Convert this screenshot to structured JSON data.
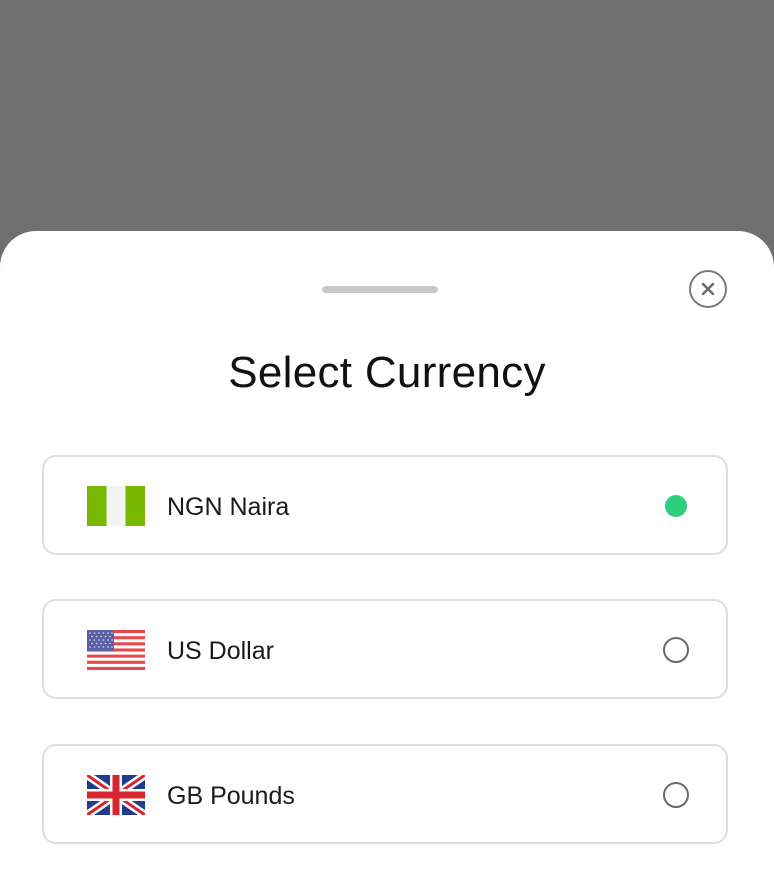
{
  "sheet": {
    "title": "Select Currency"
  },
  "currencies": [
    {
      "label": "NGN Naira",
      "flag": "nigeria-flag-icon",
      "selected": true
    },
    {
      "label": "US Dollar",
      "flag": "us-flag-icon",
      "selected": false
    },
    {
      "label": "GB Pounds",
      "flag": "uk-flag-icon",
      "selected": false
    }
  ],
  "icons": {
    "close": "close-icon"
  },
  "colors": {
    "overlay": "#6f6f6f",
    "selected_radio": "#2fce7f",
    "nigeria_green": "#78b800"
  }
}
